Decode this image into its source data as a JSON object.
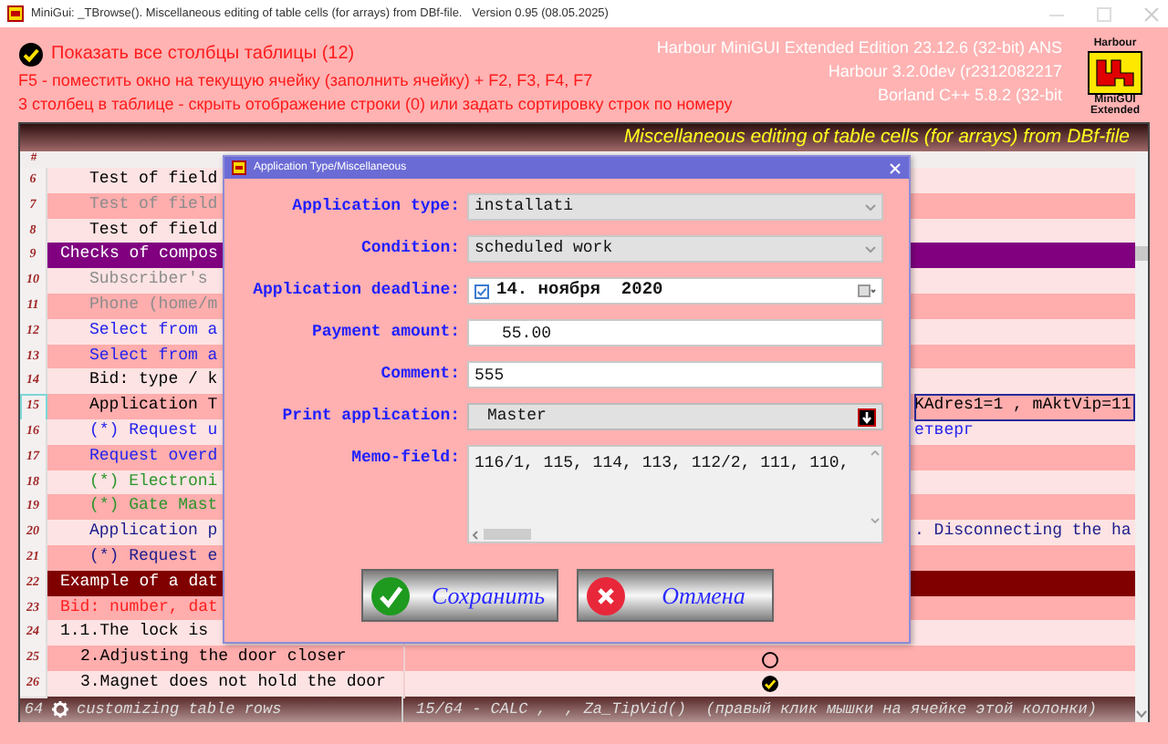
{
  "window": {
    "title": "MiniGui: _TBrowse(). Miscellaneous editing of table cells (for arrays) from DBf-file.   Version 0.95 (08.05.2025)"
  },
  "header": {
    "show_all": {
      "label": "Показать все столбцы таблицы (12)",
      "checked": true
    },
    "hints": [
      "F5 - поместить окно на текущую ячейку (заполнить ячейку) + F2, F3, F4, F7",
      "3 столбец в таблице - скрыть отображение строки (0) или задать сортировку строк по номеру"
    ],
    "versions": [
      "Harbour MiniGUI Extended Edition 23.12.6 (32-bit) ANS",
      "Harbour 3.2.0dev (r2312082217",
      "Borland C++ 5.8.2 (32-bit"
    ],
    "logo": {
      "top": "Harbour",
      "bottom": [
        "MiniGUI",
        "Extended"
      ]
    }
  },
  "table": {
    "title": "Miscellaneous editing of table cells (for arrays) from DBf-file",
    "header": "#",
    "rows": [
      {
        "number": "6",
        "text": "Test of field",
        "kind": "field",
        "color": "#000000",
        "selected": false
      },
      {
        "number": "7",
        "text": "Test of field",
        "kind": "field",
        "color": "#8c8c8c",
        "selected": false
      },
      {
        "number": "8",
        "text": "Test of field",
        "kind": "field",
        "color": "#000000",
        "selected": false
      },
      {
        "number": "9",
        "text": "Checks of compos",
        "kind": "group",
        "color": "#ffffff",
        "selected": false
      },
      {
        "number": "10",
        "text": "Subscriber's",
        "kind": "field",
        "color": "#8c8c8c",
        "selected": false
      },
      {
        "number": "11",
        "text": "Phone (home/m",
        "kind": "field",
        "color": "#8c8c8c",
        "selected": false
      },
      {
        "number": "12",
        "text": "Select from a",
        "kind": "field",
        "color": "#2222ee",
        "selected": false
      },
      {
        "number": "13",
        "text": "Select from a",
        "kind": "field",
        "color": "#2222ee",
        "selected": false
      },
      {
        "number": "14",
        "text": "Bid: type / k",
        "kind": "field",
        "color": "#000000",
        "selected": false
      },
      {
        "number": "15",
        "text": "Application T",
        "kind": "field",
        "color": "#000000",
        "selected": true,
        "extra": "KAdres1=1 , mAktVip=11"
      },
      {
        "number": "16",
        "text": "(*) Request u",
        "kind": "field",
        "color": "#2222ee",
        "selected": false,
        "extra": "етверг"
      },
      {
        "number": "17",
        "text": "Request overd",
        "kind": "field",
        "color": "#2222ee",
        "selected": false
      },
      {
        "number": "18",
        "text": "(*) Electroni",
        "kind": "field",
        "color": "#2a962a",
        "selected": false
      },
      {
        "number": "19",
        "text": "(*) Gate Mast",
        "kind": "field",
        "color": "#2a962a",
        "selected": false
      },
      {
        "number": "20",
        "text": "Application p",
        "kind": "field",
        "color": "#1c1c8c",
        "selected": false,
        "extra": ". Disconnecting the ha"
      },
      {
        "number": "21",
        "text": "(*) Request e",
        "kind": "field",
        "color": "#1c1c8c",
        "selected": false
      },
      {
        "number": "22",
        "text": "Example of a dat",
        "kind": "section",
        "color": "#ffffff",
        "selected": false
      },
      {
        "number": "23",
        "text": "Bid: number, dat",
        "kind": "plain",
        "color": "#ff2020",
        "selected": false
      },
      {
        "number": "24",
        "text": "1.1.The lock is",
        "kind": "plain",
        "color": "#000000",
        "selected": false
      },
      {
        "number": "25",
        "text": "2.Adjusting the door closer",
        "kind": "step",
        "color": "#000000",
        "selected": false,
        "checked": false
      },
      {
        "number": "26",
        "text": "3.Magnet does not hold the door",
        "kind": "step",
        "color": "#000000",
        "selected": false,
        "checked": true
      }
    ],
    "footer": {
      "count": "64",
      "label": "customizing table rows",
      "status": "15/64 - CALC ,  , Za_TipVid()",
      "hint": "(правый клик мышки на ячейке этой колонки)"
    }
  },
  "dialog": {
    "title": "Application Type/Miscellaneous",
    "fields": [
      {
        "label": "Application type:",
        "kind": "combo",
        "value": "installati"
      },
      {
        "label": "Condition:",
        "kind": "combo",
        "value": "scheduled work"
      },
      {
        "label": "Application deadline:",
        "kind": "date",
        "value": "14. ноября  2020",
        "checked": true
      },
      {
        "label": "Payment amount:",
        "kind": "number",
        "value": "55.00"
      },
      {
        "label": "Comment:",
        "kind": "text",
        "value": "555"
      },
      {
        "label": "Print application:",
        "kind": "picker",
        "value": "Master"
      },
      {
        "label": "Memo-field:",
        "kind": "memo",
        "value": "116/1, 115, 114, 113, 112/2, 111, 110,"
      }
    ],
    "buttons": [
      {
        "label": "Сохранить",
        "kind": "ok"
      },
      {
        "label": "Отмена",
        "kind": "cancel"
      }
    ]
  }
}
